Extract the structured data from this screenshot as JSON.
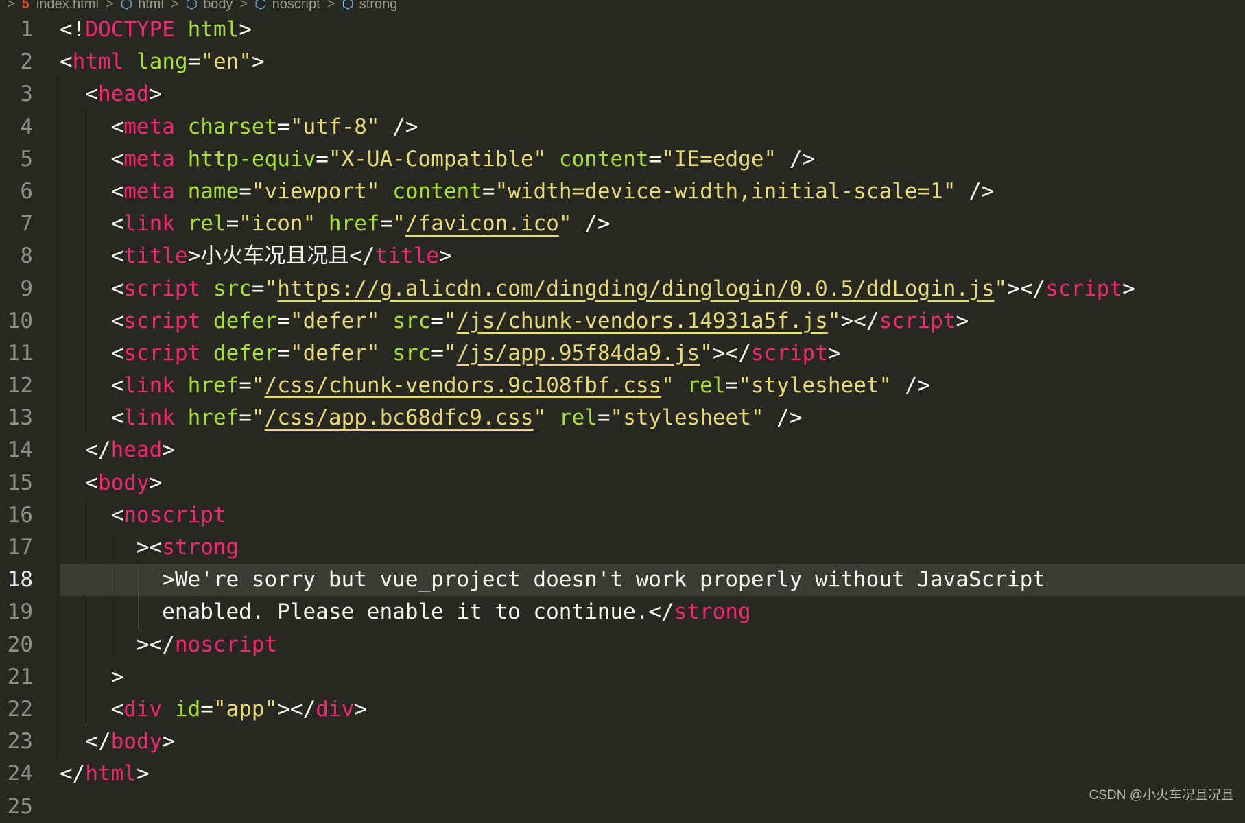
{
  "breadcrumb": {
    "items": [
      "index.html",
      "html",
      "body",
      "noscript",
      "strong"
    ],
    "sep": ">"
  },
  "theme": {
    "background": "#272822",
    "tag": "#f92672",
    "attribute": "#a6e22e",
    "string": "#e6db74",
    "text": "#f8f8f2",
    "line_number": "#90908a"
  },
  "active_line": 18,
  "lines": [
    {
      "n": "1",
      "indent": 0,
      "tokens": [
        [
          "p",
          "<!"
        ],
        [
          "t",
          "DOCTYPE"
        ],
        [
          "p",
          " "
        ],
        [
          "a",
          "html"
        ],
        [
          "p",
          ">"
        ]
      ]
    },
    {
      "n": "2",
      "indent": 0,
      "tokens": [
        [
          "p",
          "<"
        ],
        [
          "t",
          "html"
        ],
        [
          "p",
          " "
        ],
        [
          "a",
          "lang"
        ],
        [
          "p",
          "="
        ],
        [
          "s",
          "\"en\""
        ],
        [
          "p",
          ">"
        ]
      ]
    },
    {
      "n": "3",
      "indent": 1,
      "tokens": [
        [
          "p",
          "<"
        ],
        [
          "t",
          "head"
        ],
        [
          "p",
          ">"
        ]
      ]
    },
    {
      "n": "4",
      "indent": 2,
      "tokens": [
        [
          "p",
          "<"
        ],
        [
          "t",
          "meta"
        ],
        [
          "p",
          " "
        ],
        [
          "a",
          "charset"
        ],
        [
          "p",
          "="
        ],
        [
          "s",
          "\"utf-8\""
        ],
        [
          "p",
          " />"
        ]
      ]
    },
    {
      "n": "5",
      "indent": 2,
      "tokens": [
        [
          "p",
          "<"
        ],
        [
          "t",
          "meta"
        ],
        [
          "p",
          " "
        ],
        [
          "a",
          "http-equiv"
        ],
        [
          "p",
          "="
        ],
        [
          "s",
          "\"X-UA-Compatible\""
        ],
        [
          "p",
          " "
        ],
        [
          "a",
          "content"
        ],
        [
          "p",
          "="
        ],
        [
          "s",
          "\"IE=edge\""
        ],
        [
          "p",
          " />"
        ]
      ]
    },
    {
      "n": "6",
      "indent": 2,
      "tokens": [
        [
          "p",
          "<"
        ],
        [
          "t",
          "meta"
        ],
        [
          "p",
          " "
        ],
        [
          "a",
          "name"
        ],
        [
          "p",
          "="
        ],
        [
          "s",
          "\"viewport\""
        ],
        [
          "p",
          " "
        ],
        [
          "a",
          "content"
        ],
        [
          "p",
          "="
        ],
        [
          "s",
          "\"width=device-width,initial-scale=1\""
        ],
        [
          "p",
          " />"
        ]
      ]
    },
    {
      "n": "7",
      "indent": 2,
      "tokens": [
        [
          "p",
          "<"
        ],
        [
          "t",
          "link"
        ],
        [
          "p",
          " "
        ],
        [
          "a",
          "rel"
        ],
        [
          "p",
          "="
        ],
        [
          "s",
          "\"icon\""
        ],
        [
          "p",
          " "
        ],
        [
          "a",
          "href"
        ],
        [
          "p",
          "="
        ],
        [
          "s",
          "\""
        ],
        [
          "su",
          "/favicon.ico"
        ],
        [
          "s",
          "\""
        ],
        [
          "p",
          " />"
        ]
      ]
    },
    {
      "n": "8",
      "indent": 2,
      "tokens": [
        [
          "p",
          "<"
        ],
        [
          "t",
          "title"
        ],
        [
          "p",
          ">"
        ],
        [
          "c",
          "小火车况且况且"
        ],
        [
          "p",
          "</"
        ],
        [
          "t",
          "title"
        ],
        [
          "p",
          ">"
        ]
      ]
    },
    {
      "n": "9",
      "indent": 2,
      "tokens": [
        [
          "p",
          "<"
        ],
        [
          "t",
          "script"
        ],
        [
          "p",
          " "
        ],
        [
          "a",
          "src"
        ],
        [
          "p",
          "="
        ],
        [
          "s",
          "\""
        ],
        [
          "su",
          "https://g.alicdn.com/dingding/dinglogin/0.0.5/ddLogin.js"
        ],
        [
          "s",
          "\""
        ],
        [
          "p",
          "></"
        ],
        [
          "t",
          "script"
        ],
        [
          "p",
          ">"
        ]
      ]
    },
    {
      "n": "10",
      "indent": 2,
      "tokens": [
        [
          "p",
          "<"
        ],
        [
          "t",
          "script"
        ],
        [
          "p",
          " "
        ],
        [
          "a",
          "defer"
        ],
        [
          "p",
          "="
        ],
        [
          "s",
          "\"defer\""
        ],
        [
          "p",
          " "
        ],
        [
          "a",
          "src"
        ],
        [
          "p",
          "="
        ],
        [
          "s",
          "\""
        ],
        [
          "su",
          "/js/chunk-vendors.14931a5f.js"
        ],
        [
          "s",
          "\""
        ],
        [
          "p",
          "></"
        ],
        [
          "t",
          "script"
        ],
        [
          "p",
          ">"
        ]
      ]
    },
    {
      "n": "11",
      "indent": 2,
      "tokens": [
        [
          "p",
          "<"
        ],
        [
          "t",
          "script"
        ],
        [
          "p",
          " "
        ],
        [
          "a",
          "defer"
        ],
        [
          "p",
          "="
        ],
        [
          "s",
          "\"defer\""
        ],
        [
          "p",
          " "
        ],
        [
          "a",
          "src"
        ],
        [
          "p",
          "="
        ],
        [
          "s",
          "\""
        ],
        [
          "su",
          "/js/app.95f84da9.js"
        ],
        [
          "s",
          "\""
        ],
        [
          "p",
          "></"
        ],
        [
          "t",
          "script"
        ],
        [
          "p",
          ">"
        ]
      ]
    },
    {
      "n": "12",
      "indent": 2,
      "tokens": [
        [
          "p",
          "<"
        ],
        [
          "t",
          "link"
        ],
        [
          "p",
          " "
        ],
        [
          "a",
          "href"
        ],
        [
          "p",
          "="
        ],
        [
          "s",
          "\""
        ],
        [
          "su",
          "/css/chunk-vendors.9c108fbf.css"
        ],
        [
          "s",
          "\""
        ],
        [
          "p",
          " "
        ],
        [
          "a",
          "rel"
        ],
        [
          "p",
          "="
        ],
        [
          "s",
          "\"stylesheet\""
        ],
        [
          "p",
          " />"
        ]
      ]
    },
    {
      "n": "13",
      "indent": 2,
      "tokens": [
        [
          "p",
          "<"
        ],
        [
          "t",
          "link"
        ],
        [
          "p",
          " "
        ],
        [
          "a",
          "href"
        ],
        [
          "p",
          "="
        ],
        [
          "s",
          "\""
        ],
        [
          "su",
          "/css/app.bc68dfc9.css"
        ],
        [
          "s",
          "\""
        ],
        [
          "p",
          " "
        ],
        [
          "a",
          "rel"
        ],
        [
          "p",
          "="
        ],
        [
          "s",
          "\"stylesheet\""
        ],
        [
          "p",
          " />"
        ]
      ]
    },
    {
      "n": "14",
      "indent": 1,
      "tokens": [
        [
          "p",
          "</"
        ],
        [
          "t",
          "head"
        ],
        [
          "p",
          ">"
        ]
      ]
    },
    {
      "n": "15",
      "indent": 1,
      "tokens": [
        [
          "p",
          "<"
        ],
        [
          "t",
          "body"
        ],
        [
          "p",
          ">"
        ]
      ]
    },
    {
      "n": "16",
      "indent": 2,
      "tokens": [
        [
          "p",
          "<"
        ],
        [
          "t",
          "noscript"
        ]
      ]
    },
    {
      "n": "17",
      "indent": 3,
      "tokens": [
        [
          "p",
          "><"
        ],
        [
          "t",
          "strong"
        ]
      ]
    },
    {
      "n": "18",
      "indent": 4,
      "tokens": [
        [
          "x",
          ">We're sorry but vue_project doesn't work properly without JavaScript"
        ]
      ]
    },
    {
      "n": "19",
      "indent": 4,
      "tokens": [
        [
          "x",
          "enabled. Please enable it to continue.</"
        ],
        [
          "t",
          "strong"
        ]
      ]
    },
    {
      "n": "20",
      "indent": 3,
      "tokens": [
        [
          "p",
          "></"
        ],
        [
          "t",
          "noscript"
        ]
      ]
    },
    {
      "n": "21",
      "indent": 2,
      "tokens": [
        [
          "p",
          ">"
        ]
      ]
    },
    {
      "n": "22",
      "indent": 2,
      "tokens": [
        [
          "p",
          "<"
        ],
        [
          "t",
          "div"
        ],
        [
          "p",
          " "
        ],
        [
          "a",
          "id"
        ],
        [
          "p",
          "="
        ],
        [
          "s",
          "\"app\""
        ],
        [
          "p",
          "></"
        ],
        [
          "t",
          "div"
        ],
        [
          "p",
          ">"
        ]
      ]
    },
    {
      "n": "23",
      "indent": 1,
      "tokens": [
        [
          "p",
          "</"
        ],
        [
          "t",
          "body"
        ],
        [
          "p",
          ">"
        ]
      ]
    },
    {
      "n": "24",
      "indent": 0,
      "tokens": [
        [
          "p",
          "</"
        ],
        [
          "t",
          "html"
        ],
        [
          "p",
          ">"
        ]
      ]
    },
    {
      "n": "25",
      "indent": 0,
      "tokens": []
    }
  ],
  "watermark": "CSDN @小火车况且况且"
}
